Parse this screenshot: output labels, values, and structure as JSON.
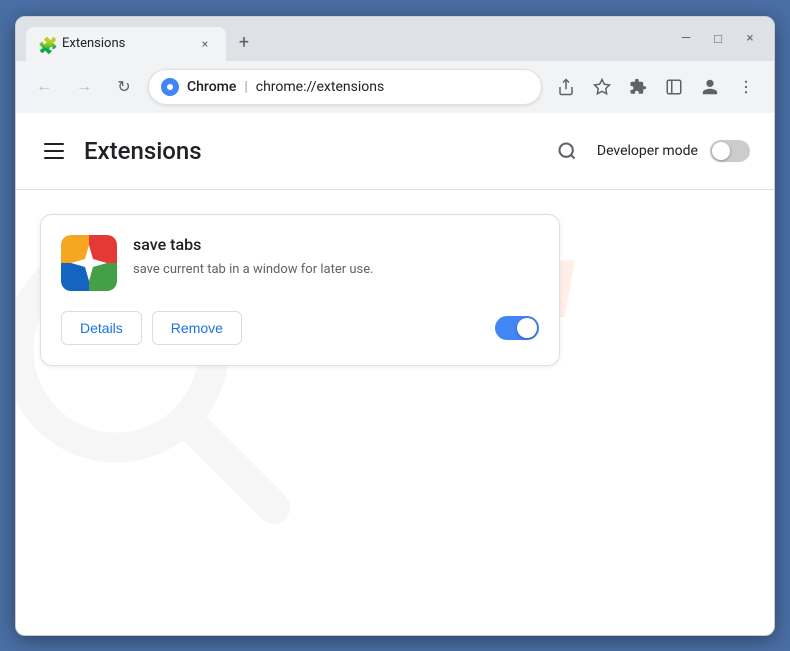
{
  "window": {
    "title": "Extensions",
    "favicon": "🧩",
    "tab_close": "×",
    "tab_new": "+",
    "controls": {
      "minimize": "—",
      "maximize": "□",
      "close": "×"
    }
  },
  "nav": {
    "back": "←",
    "forward": "→",
    "refresh": "↻",
    "site_name": "Chrome",
    "url_full": "chrome://extensions",
    "share_icon": "⎙",
    "star_icon": "☆",
    "extensions_icon": "🧩",
    "sidebar_icon": "▭",
    "account_icon": "👤",
    "menu_icon": "⋮"
  },
  "page": {
    "title": "Extensions",
    "search_label": "Search",
    "developer_mode_label": "Developer mode",
    "developer_mode_on": false
  },
  "extension": {
    "name": "save tabs",
    "description": "save current tab in a window for later use.",
    "details_label": "Details",
    "remove_label": "Remove",
    "enabled": true
  },
  "watermark": {
    "text": "RISK.COM"
  }
}
